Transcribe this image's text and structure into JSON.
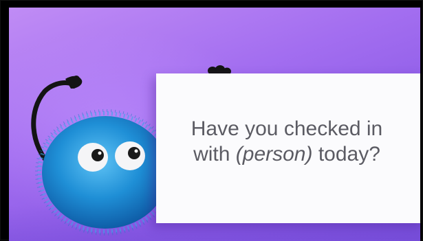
{
  "card": {
    "line1": "Have you checked in",
    "line2_prefix": "with ",
    "line2_emphasis": "(person)",
    "line2_suffix": " today?"
  },
  "colors": {
    "background": "#9a66ee",
    "card": "#fbfbfd",
    "text": "#5b5b63",
    "creature_fur": "#1f8fd6",
    "arm": "#141414"
  },
  "icons": [
    "fluffy-creature-icon",
    "eye-icon",
    "arm-icon",
    "hand-icon"
  ]
}
